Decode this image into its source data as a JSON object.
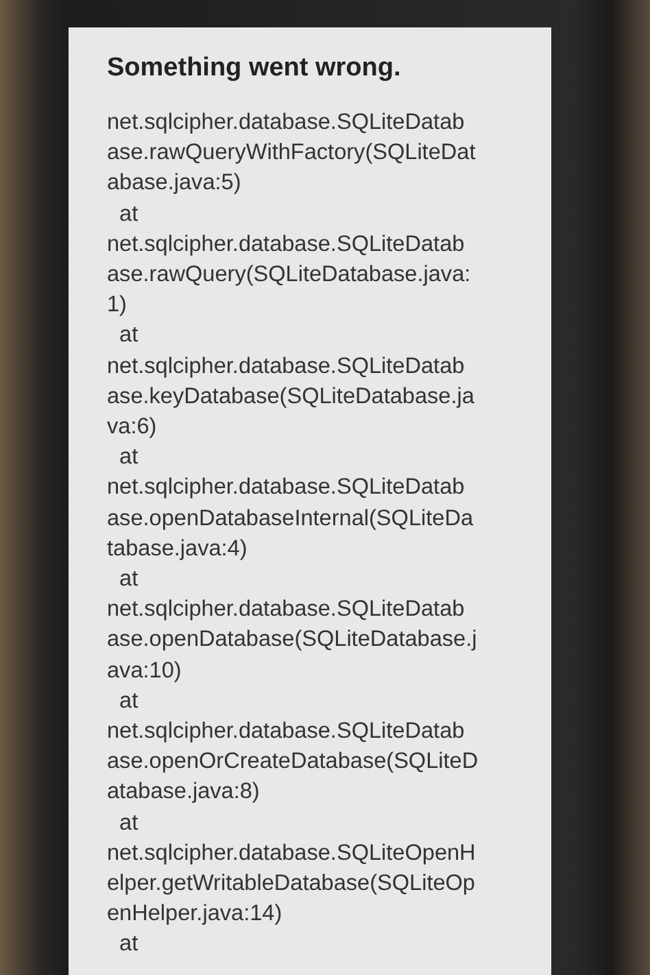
{
  "dialog": {
    "title": "Something went wrong.",
    "lines": [
      "net.sqlcipher.database.SQLiteDatab",
      "ase.rawQueryWithFactory(SQLiteDat",
      "abase.java:5)",
      "  at",
      "net.sqlcipher.database.SQLiteDatab",
      "ase.rawQuery(SQLiteDatabase.java:",
      "1)",
      "  at",
      "net.sqlcipher.database.SQLiteDatab",
      "ase.keyDatabase(SQLiteDatabase.ja",
      "va:6)",
      "  at",
      "net.sqlcipher.database.SQLiteDatab",
      "ase.openDatabaseInternal(SQLiteDa",
      "tabase.java:4)",
      "  at",
      "net.sqlcipher.database.SQLiteDatab",
      "ase.openDatabase(SQLiteDatabase.j",
      "ava:10)",
      "  at",
      "net.sqlcipher.database.SQLiteDatab",
      "ase.openOrCreateDatabase(SQLiteD",
      "atabase.java:8)",
      "  at",
      "net.sqlcipher.database.SQLiteOpenH",
      "elper.getWritableDatabase(SQLiteOp",
      "enHelper.java:14)",
      "  at"
    ]
  }
}
